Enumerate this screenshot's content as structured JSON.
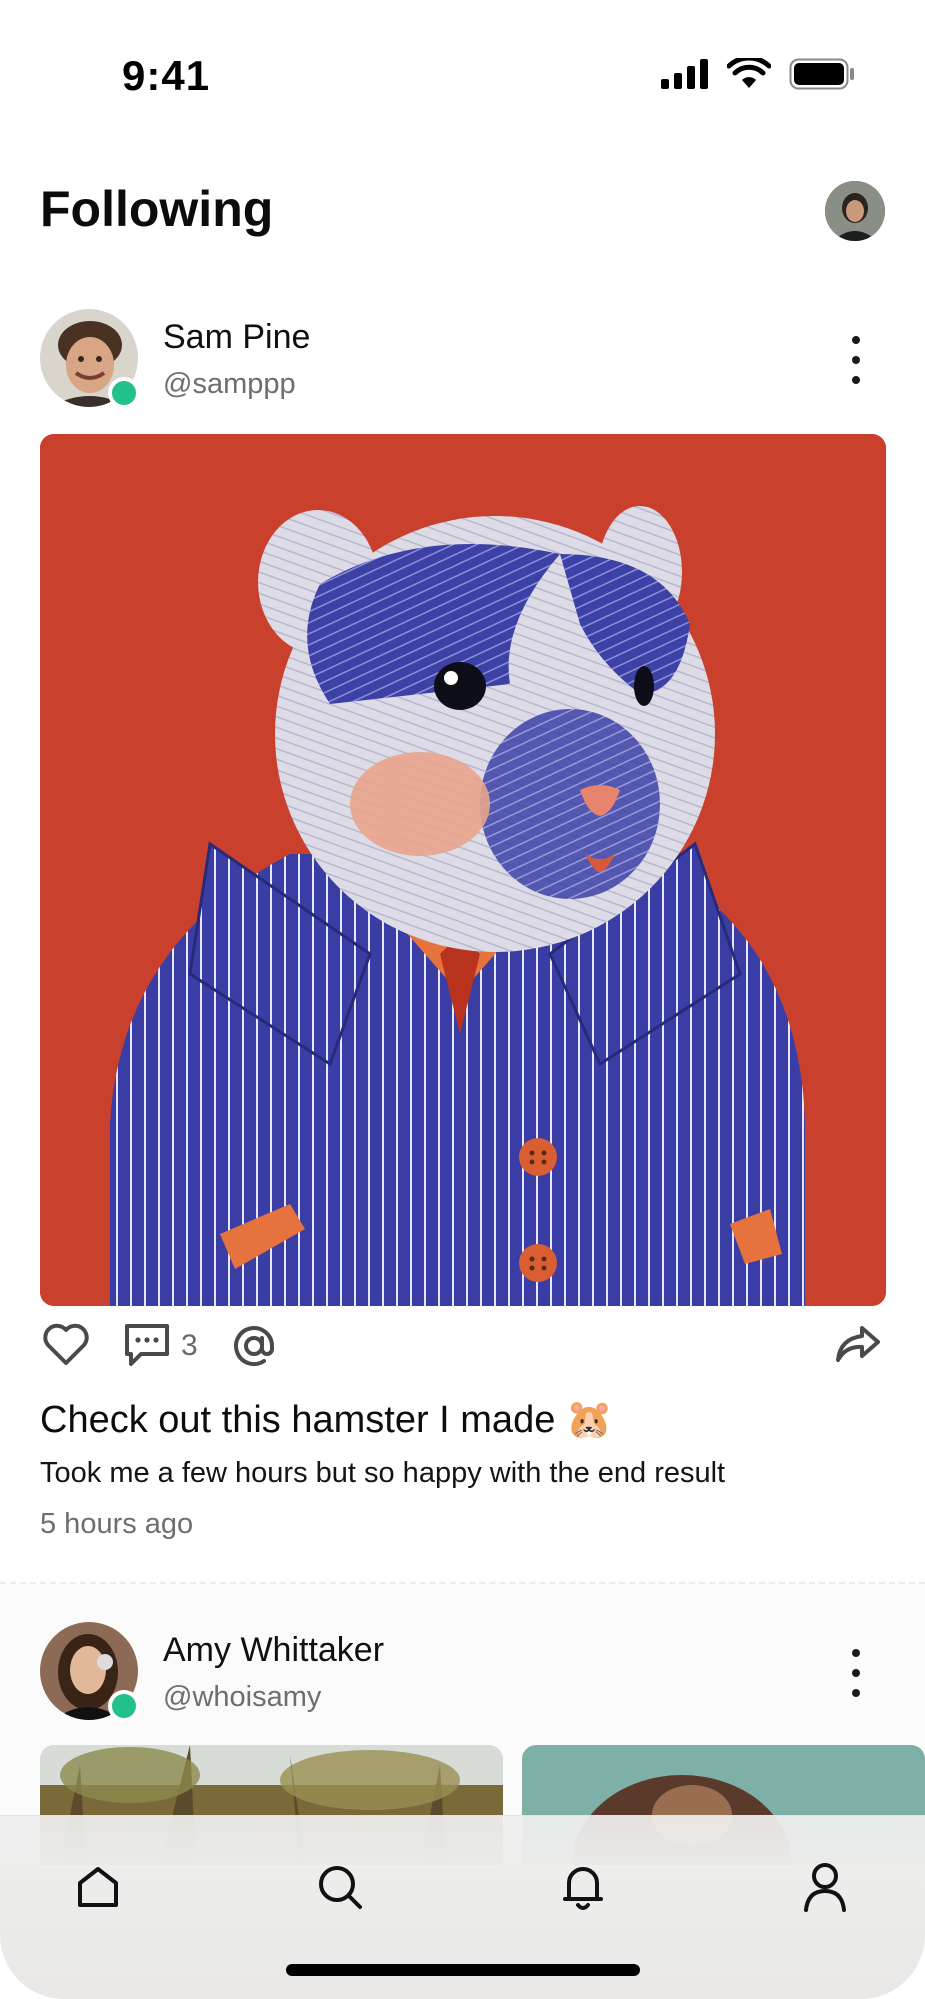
{
  "status_bar": {
    "time": "9:41"
  },
  "header": {
    "title": "Following"
  },
  "posts": [
    {
      "author_name": "Sam Pine",
      "author_handle": "@samppp",
      "online": true,
      "comments_count": "3",
      "title": "Check out this hamster I made",
      "title_emoji": "🐹",
      "caption": "Took me a few hours but so happy with the end result",
      "time_ago": "5 hours ago"
    },
    {
      "author_name": "Amy Whittaker",
      "author_handle": "@whoisamy",
      "online": true
    }
  ],
  "colors": {
    "online": "#22c08a",
    "image_background": "#c9412c",
    "hamster_suit": "#3b3fa0"
  },
  "tab_bar": {
    "items": [
      {
        "icon": "home-icon"
      },
      {
        "icon": "search-icon"
      },
      {
        "icon": "bell-icon"
      },
      {
        "icon": "profile-icon"
      }
    ]
  }
}
